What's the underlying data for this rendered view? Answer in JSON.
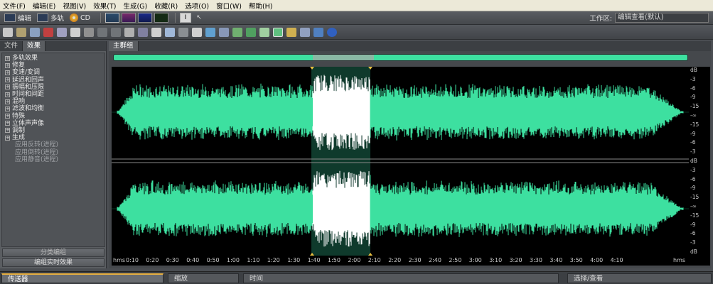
{
  "menu": [
    "文件(F)",
    "编辑(E)",
    "视图(V)",
    "效果(T)",
    "生成(G)",
    "收藏(R)",
    "选项(O)",
    "窗口(W)",
    "帮助(H)"
  ],
  "modes": {
    "edit": "编辑",
    "multitrack": "多轨",
    "cd": "CD"
  },
  "workspace": {
    "label": "工作区:",
    "value": "编辑查看(默认)"
  },
  "left_panel": {
    "tabs": [
      "文件",
      "效果"
    ],
    "effects": [
      "多轨效果",
      "修复",
      "变速/变调",
      "延迟和回声",
      "振幅和压限",
      "时间和间距",
      "混响",
      "滤波和均衡",
      "特殊",
      "立体声声像",
      "调制",
      "生成"
    ],
    "sub_items": [
      "应用反转(进程)",
      "应用倒转(进程)",
      "应用静音(进程)"
    ],
    "btn_group": "分类编组",
    "btn_realtime": "编组实时效果"
  },
  "main_panel": {
    "tab": "主群组",
    "db_ticks": [
      "dB",
      "-3",
      "-6",
      "-9",
      "-15",
      "-∞",
      "-15",
      "-9",
      "-6",
      "-3",
      "dB",
      "-3",
      "-6",
      "-9",
      "-15",
      "-∞",
      "-15",
      "-9",
      "-6",
      "-3",
      "dB"
    ],
    "time_ticks": [
      "hms",
      "0:10",
      "0:20",
      "0:30",
      "0:40",
      "0:50",
      "1:00",
      "1:10",
      "1:20",
      "1:30",
      "1:40",
      "1:50",
      "2:00",
      "2:10",
      "2:20",
      "2:30",
      "2:40",
      "2:50",
      "3:00",
      "3:10",
      "3:20",
      "3:30",
      "3:40",
      "3:50",
      "4:00",
      "4:10",
      "hms"
    ]
  },
  "bottom_tabs": [
    "传送器",
    "缩放",
    "时间",
    "选择/查看"
  ],
  "colors": {
    "wave": "#3de0a0",
    "selection_bg": "#0f3a2c",
    "selection_wave": "#ffffff",
    "marker": "#e8c040"
  }
}
